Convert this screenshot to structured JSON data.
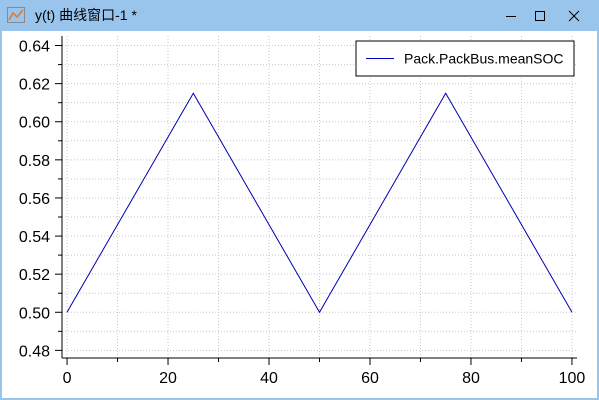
{
  "window": {
    "title": "y(t) 曲线窗口-1 *",
    "app_icon": "curve-chart-icon",
    "controls": [
      "minimize-icon",
      "maximize-icon",
      "close-icon"
    ],
    "titlebar_color": "#99c5ec"
  },
  "chart_data": {
    "type": "line",
    "title": "",
    "xlabel": "",
    "ylabel": "",
    "xlim": [
      -1,
      101
    ],
    "ylim": [
      0.476,
      0.645
    ],
    "x_ticks": [
      0,
      20,
      40,
      60,
      80,
      100
    ],
    "x_tick_labels": [
      "0",
      "20",
      "40",
      "60",
      "80",
      "100"
    ],
    "y_ticks": [
      0.48,
      0.5,
      0.52,
      0.54,
      0.56,
      0.58,
      0.6,
      0.62,
      0.64
    ],
    "y_tick_labels": [
      "0.48",
      "0.50",
      "0.52",
      "0.54",
      "0.56",
      "0.58",
      "0.60",
      "0.62",
      "0.64"
    ],
    "grid": true,
    "legend_position": "top-right",
    "series": [
      {
        "name": "Pack.PackBus.meanSOC",
        "color": "#0000b4",
        "x": [
          0,
          25,
          50,
          75,
          100
        ],
        "y": [
          0.5,
          0.615,
          0.5,
          0.615,
          0.5
        ]
      }
    ]
  }
}
